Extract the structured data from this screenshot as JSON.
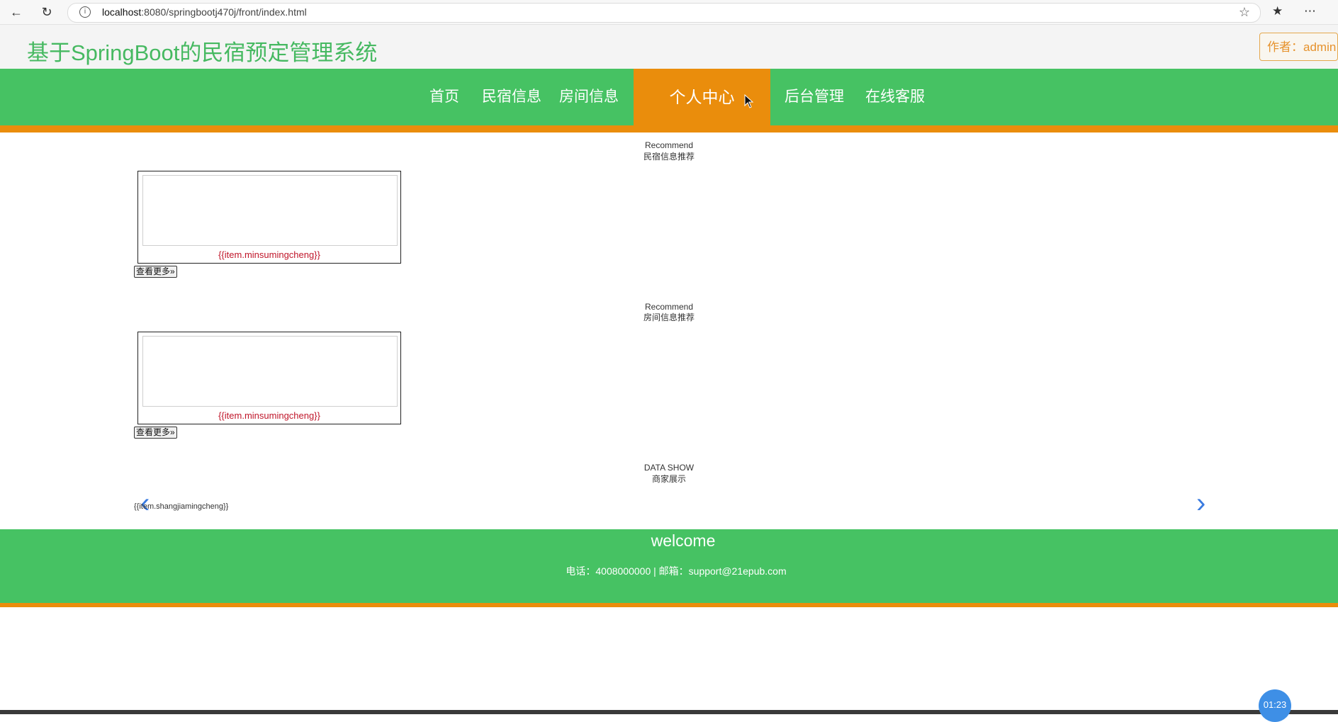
{
  "browser": {
    "url_host": "localhost",
    "url_rest": ":8080/springbootj470j/front/index.html"
  },
  "header": {
    "title": "基于SpringBoot的民宿预定管理系统",
    "author": "作者：admin"
  },
  "nav": {
    "items": [
      "首页",
      "民宿信息",
      "房间信息",
      "个人中心",
      "后台管理",
      "在线客服"
    ],
    "active": "个人中心"
  },
  "sections": {
    "homestay": {
      "en": "Recommend",
      "cn": "民宿信息推荐",
      "card_label": "{{item.minsumingcheng}}",
      "more": "查看更多"
    },
    "room": {
      "en": "Recommend",
      "cn": "房间信息推荐",
      "card_label": "{{item.minsumingcheng}}",
      "more": "查看更多"
    },
    "merchant": {
      "en": "DATA SHOW",
      "cn": "商家展示",
      "item_label": "{{item.shangjiamingcheng}}"
    }
  },
  "footer": {
    "welcome": "welcome",
    "contact": "电话：4008000000 | 邮箱：support@21epub.com"
  },
  "timer": "01:23",
  "colors": {
    "green": "#46c263",
    "orange": "#ea8d0c",
    "title_green": "#46b961",
    "label_red": "#c0162a",
    "arrow_blue": "#3a7be0"
  }
}
